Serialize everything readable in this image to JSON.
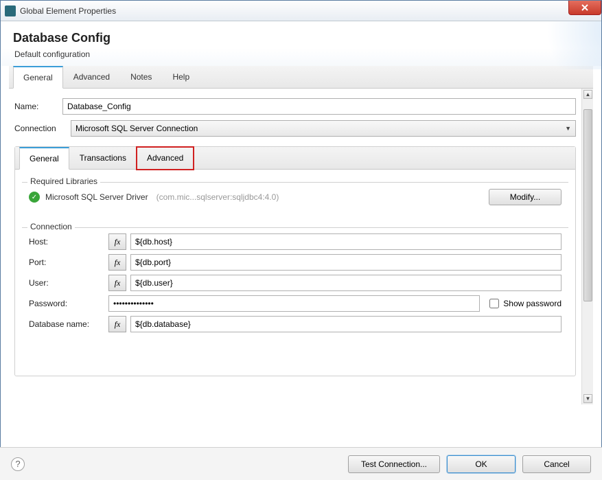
{
  "window": {
    "title": "Global Element Properties"
  },
  "header": {
    "title": "Database Config",
    "subtitle": "Default configuration"
  },
  "mainTabs": {
    "general": "General",
    "advanced": "Advanced",
    "notes": "Notes",
    "help": "Help"
  },
  "form": {
    "nameLabel": "Name:",
    "nameValue": "Database_Config",
    "connectionLabel": "Connection",
    "connectionValue": "Microsoft SQL Server Connection"
  },
  "innerTabs": {
    "general": "General",
    "transactions": "Transactions",
    "advanced": "Advanced"
  },
  "requiredLibs": {
    "legend": "Required Libraries",
    "driverName": "Microsoft SQL Server Driver",
    "driverDetail": "(com.mic...sqlserver:sqljdbc4:4.0)",
    "modifyLabel": "Modify..."
  },
  "connection": {
    "legend": "Connection",
    "hostLabel": "Host:",
    "hostValue": "${db.host}",
    "portLabel": "Port:",
    "portValue": "${db.port}",
    "userLabel": "User:",
    "userValue": "${db.user}",
    "passwordLabel": "Password:",
    "passwordValue": "••••••••••••••",
    "showPasswordLabel": "Show password",
    "dbNameLabel": "Database name:",
    "dbNameValue": "${db.database}",
    "fxLabel": "fx"
  },
  "footer": {
    "testConnection": "Test Connection...",
    "ok": "OK",
    "cancel": "Cancel"
  }
}
